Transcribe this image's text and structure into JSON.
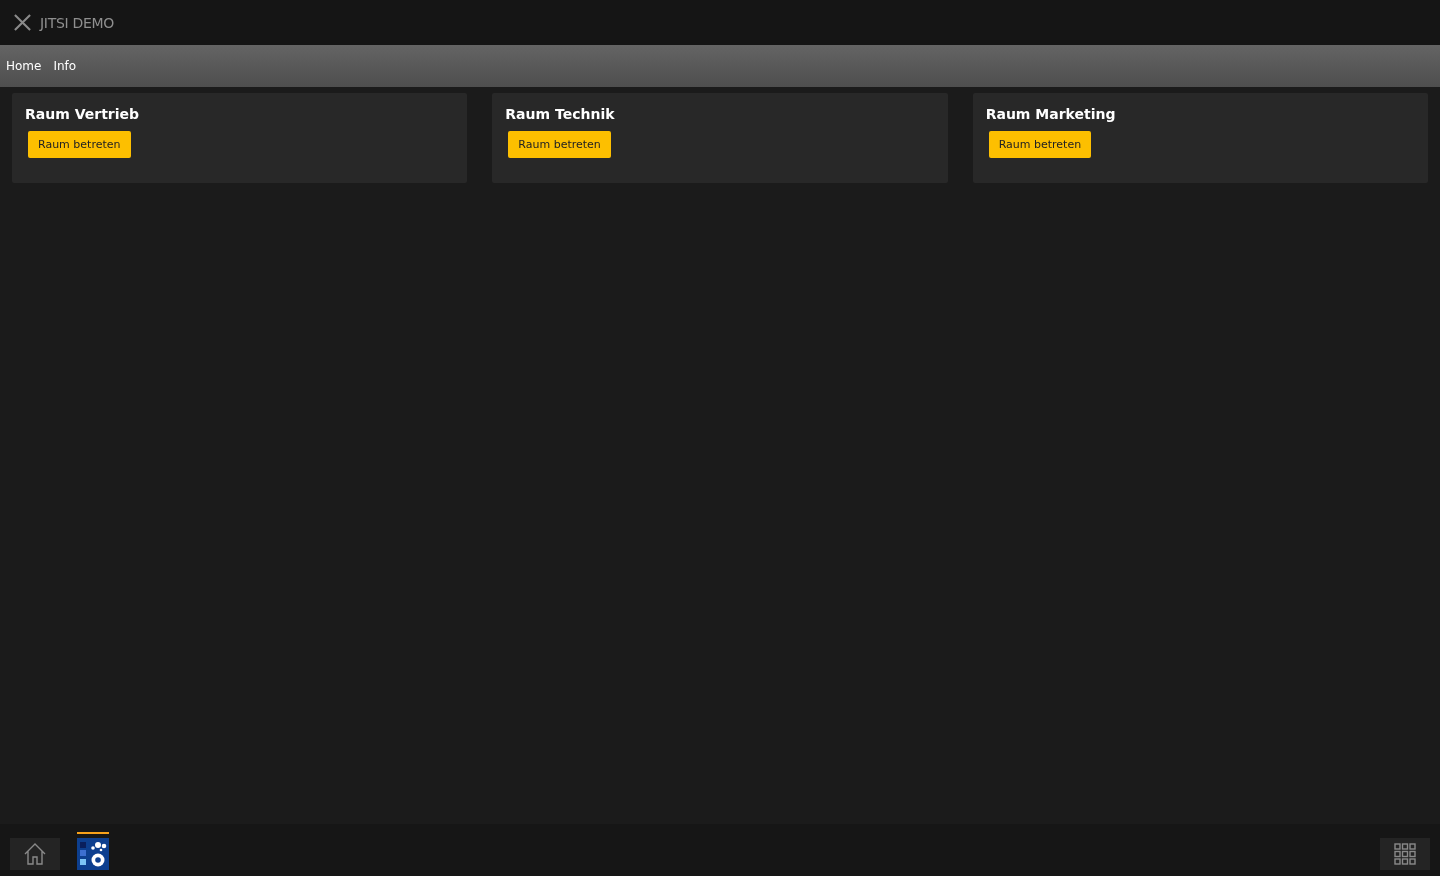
{
  "window": {
    "title": "JITSI DEMO"
  },
  "nav": [
    {
      "label": "Home"
    },
    {
      "label": "Info"
    }
  ],
  "rooms": [
    {
      "name": "Raum Vertrieb",
      "button": "Raum betreten"
    },
    {
      "name": "Raum Technik",
      "button": "Raum betreten"
    },
    {
      "name": "Raum Marketing",
      "button": "Raum betreten"
    }
  ],
  "taskbar": {
    "apps": [
      {
        "kind": "home",
        "selected": false
      },
      {
        "kind": "app",
        "selected": true
      }
    ]
  }
}
